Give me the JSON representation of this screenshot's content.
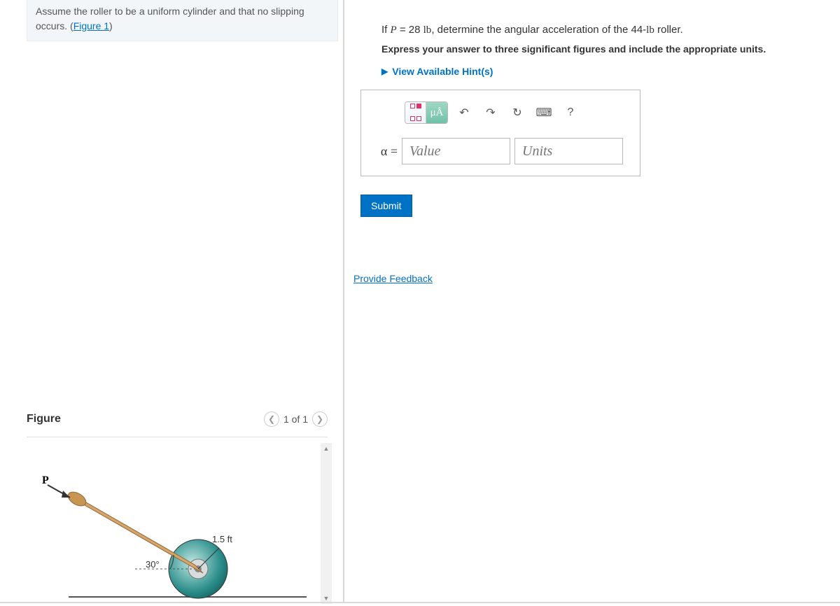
{
  "problem": {
    "text_part1": "Assume the roller to be a uniform cylinder and that no slipping occurs. (",
    "figure_link": "Figure 1",
    "text_part2": ")"
  },
  "figure": {
    "title": "Figure",
    "page_label": "1 of 1",
    "labels": {
      "force": "P",
      "angle": "30°",
      "radius": "1.5 ft"
    }
  },
  "question": {
    "line_prefix": "If ",
    "variable": "P",
    "equals_value": " = 28 ",
    "unit1": "lb",
    "mid": ", determine the angular acceleration of the 44-",
    "unit2": "lb",
    "suffix": " roller.",
    "instruction": "Express your answer to three significant figures and include the appropriate units.",
    "hints_label": "View Available Hint(s)"
  },
  "answer": {
    "alpha_label": "α =",
    "value_placeholder": "Value",
    "units_placeholder": "Units",
    "toolbar": {
      "ua_label": "μÅ",
      "help_label": "?"
    }
  },
  "buttons": {
    "submit": "Submit",
    "feedback": "Provide Feedback"
  }
}
